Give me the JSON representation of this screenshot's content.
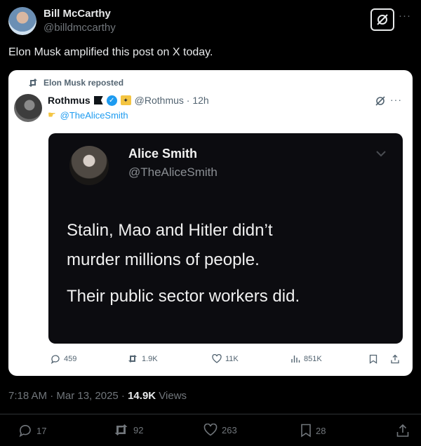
{
  "header": {
    "name": "Bill McCarthy",
    "handle": "@billdmccarthy",
    "more": "···"
  },
  "post_text": "Elon Musk amplified this post on X today.",
  "screenshot": {
    "repost_label": "Elon Musk reposted",
    "name": "Rothmus",
    "handle": "@Rothmus · 12h",
    "mention": "@TheAliceSmith",
    "more": "···",
    "quoted": {
      "name": "Alice Smith",
      "handle": "@TheAliceSmith",
      "lines": [
        "Stalin, Mao and Hitler didn’t",
        "murder millions of people.",
        "Their public sector workers did."
      ]
    },
    "actions": {
      "replies": "459",
      "reposts": "1.9K",
      "likes": "11K",
      "views": "851K"
    }
  },
  "meta": {
    "time": "7:18 AM · Mar 13, 2025 · ",
    "views_count": "14.9K",
    "views_label": " Views"
  },
  "actions": {
    "replies": "17",
    "reposts": "92",
    "likes": "263",
    "bookmarks": "28"
  }
}
